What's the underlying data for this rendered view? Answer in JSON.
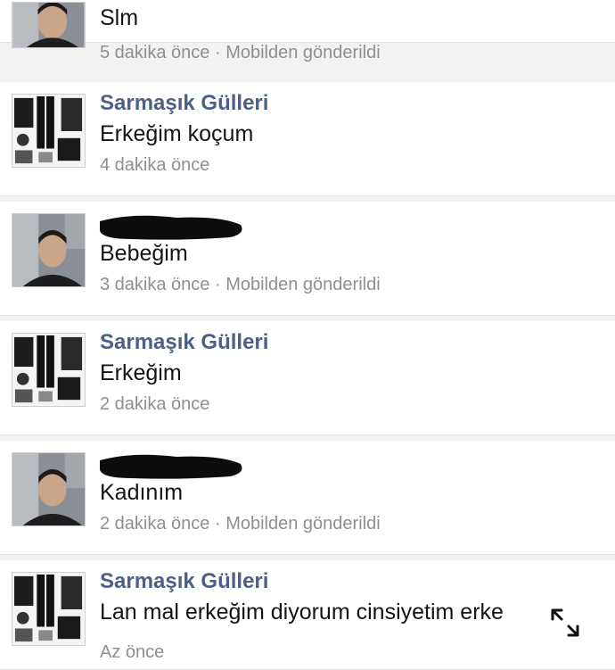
{
  "messages": [
    {
      "sender_type": "redacted",
      "text": "Slm",
      "time": "5 dakika önce",
      "separator": " · ",
      "source": "Mobilden gönderildi"
    },
    {
      "sender_type": "named",
      "sender": "Sarmaşık Gülleri",
      "text": "Erkeğim koçum",
      "time": "4 dakika önce"
    },
    {
      "sender_type": "redacted",
      "text": "Bebeğim",
      "time": "3 dakika önce",
      "separator": " · ",
      "source": "Mobilden gönderildi"
    },
    {
      "sender_type": "named",
      "sender": "Sarmaşık Gülleri",
      "text": "Erkeğim",
      "time": "2 dakika önce"
    },
    {
      "sender_type": "redacted",
      "text": "Kadınım",
      "time": "2 dakika önce",
      "separator": " · ",
      "source": "Mobilden gönderildi"
    },
    {
      "sender_type": "named",
      "sender": "Sarmaşık Gülleri",
      "text": "Lan mal erkeğim diyorum cinsiyetim erke",
      "time": "Az önce"
    }
  ],
  "icons": {
    "man_avatar": "person-photo-icon",
    "clothes_avatar": "clothing-collage-icon",
    "expand": "expand-arrows-icon"
  },
  "colors": {
    "sender_name": "#4c5f85",
    "meta_text": "#8f8f8f",
    "message_text": "#141414"
  }
}
